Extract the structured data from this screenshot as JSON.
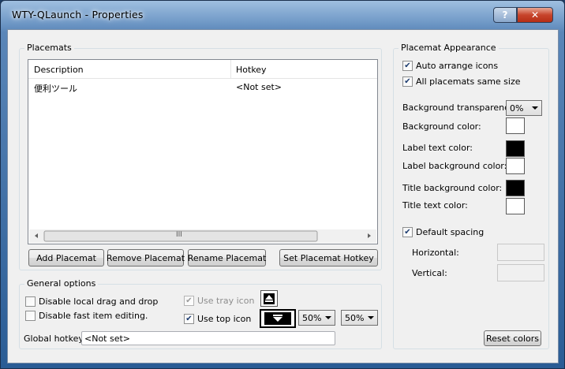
{
  "window": {
    "title": "WTY-QLaunch - Properties",
    "help_glyph": "?",
    "close_glyph": "✕"
  },
  "placemats": {
    "group_label": "Placemats",
    "columns": [
      "Description",
      "Hotkey"
    ],
    "rows": [
      {
        "description": "便利ツール",
        "hotkey": "<Not set>"
      }
    ],
    "scroll_grip": "III",
    "buttons": {
      "add": "Add Placemat",
      "remove": "Remove Placemat",
      "rename": "Rename Placemat",
      "set_hotkey": "Set Placemat Hotkey"
    }
  },
  "general": {
    "group_label": "General options",
    "disable_drag": "Disable local drag and drop",
    "disable_edit": "Disable fast item editing.",
    "use_tray_icon": "Use tray icon",
    "use_top_icon": "Use top icon",
    "size_a": "50%",
    "size_b": "50%",
    "hotkey_label": "Global hotkey:",
    "hotkey_value": "<Not set>",
    "checks": {
      "disable_drag": false,
      "disable_edit": false,
      "use_tray_icon": true,
      "use_top_icon": true
    }
  },
  "appearance": {
    "group_label": "Placemat Appearance",
    "auto_arrange": "Auto arrange icons",
    "same_size": "All placemats same size",
    "transparency_label": "Background transparency:",
    "transparency_value": "0%",
    "bg_color_label": "Background color:",
    "label_text_label": "Label text color:",
    "label_bg_label": "Label background color:",
    "title_bg_label": "Title background color:",
    "title_text_label": "Title text color:",
    "default_spacing": "Default spacing",
    "horizontal_label": "Horizontal:",
    "vertical_label": "Vertical:",
    "reset_label": "Reset colors",
    "checks": {
      "auto_arrange": true,
      "same_size": true,
      "default_spacing": true
    },
    "colors": {
      "background": "#ffffff",
      "label_text": "#000000",
      "label_background": "#ffffff",
      "title_background": "#000000",
      "title_text": "#ffffff"
    }
  },
  "check_glyph": "✔"
}
